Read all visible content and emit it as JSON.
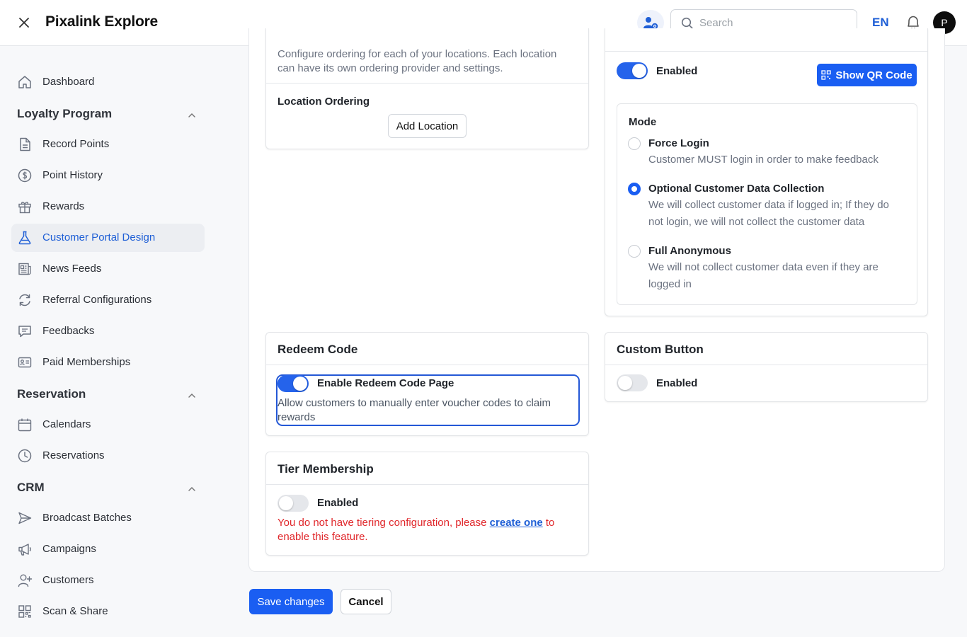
{
  "header": {
    "title": "Pixalink Explore",
    "search_placeholder": "Search",
    "language": "EN",
    "avatar_initial": "P"
  },
  "sidebar": {
    "dashboard": "Dashboard",
    "loyalty": {
      "label": "Loyalty Program",
      "items": [
        "Record Points",
        "Point History",
        "Rewards",
        "Customer Portal Design",
        "News Feeds",
        "Referral Configurations",
        "Feedbacks",
        "Paid Memberships"
      ],
      "active": "Customer Portal Design"
    },
    "reservation": {
      "label": "Reservation",
      "items": [
        "Calendars",
        "Reservations"
      ]
    },
    "crm": {
      "label": "CRM",
      "items": [
        "Broadcast Batches",
        "Campaigns",
        "Customers",
        "Scan & Share"
      ]
    }
  },
  "ordering": {
    "description": "Configure ordering for each of your locations. Each location can have its own ordering provider and settings.",
    "location_label": "Location Ordering",
    "add_location": "Add Location"
  },
  "feedback": {
    "enabled_label": "Enabled",
    "enabled": true,
    "show_qr": "Show QR Code",
    "mode_label": "Mode",
    "options": [
      {
        "title": "Force Login",
        "desc": "Customer MUST login in order to make feedback",
        "selected": false
      },
      {
        "title": "Optional Customer Data Collection",
        "desc": "We will collect customer data if logged in; If they do not login, we will not collect the customer data",
        "selected": true
      },
      {
        "title": "Full Anonymous",
        "desc": "We will not collect customer data even if they are logged in",
        "selected": false
      }
    ]
  },
  "redeem_code": {
    "title": "Redeem Code",
    "toggle_label": "Enable Redeem Code Page",
    "enabled": true,
    "desc": "Allow customers to manually enter voucher codes to claim rewards"
  },
  "custom_button": {
    "title": "Custom Button",
    "toggle_label": "Enabled",
    "enabled": false
  },
  "tier_membership": {
    "title": "Tier Membership",
    "toggle_label": "Enabled",
    "enabled": false,
    "error_prefix": "You do not have tiering configuration, please ",
    "error_link": "create one",
    "error_suffix": " to enable this feature."
  },
  "actions": {
    "save": "Save changes",
    "cancel": "Cancel"
  },
  "colors": {
    "accent": "#1a5ef2",
    "error": "#e0272b"
  }
}
